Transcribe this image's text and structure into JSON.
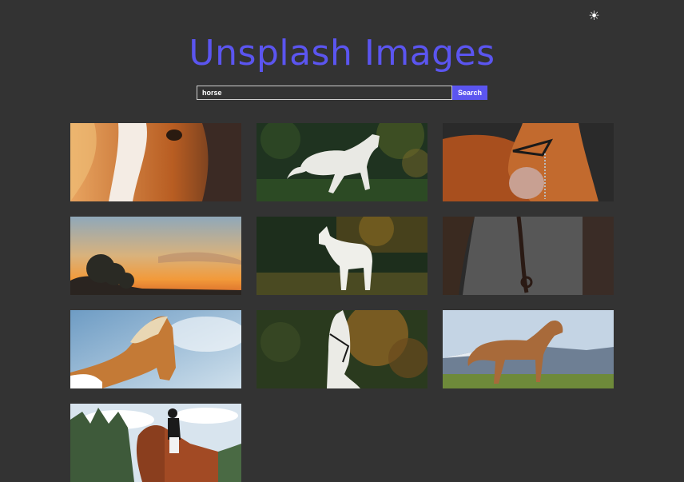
{
  "header": {
    "title": "Unsplash Images",
    "theme_icon": "sun-icon"
  },
  "search": {
    "value": "horse",
    "button_label": "Search"
  },
  "colors": {
    "background": "#333333",
    "accent": "#5b55f0",
    "text": "#ffffff"
  },
  "results": [
    {
      "subject": "horse-face-closeup"
    },
    {
      "subject": "white-horse-galloping"
    },
    {
      "subject": "chestnut-horse-bridle"
    },
    {
      "subject": "sunset-over-trees"
    },
    {
      "subject": "white-horse-standing-in-forest"
    },
    {
      "subject": "dark-horse-closeup"
    },
    {
      "subject": "palomino-horse-sky"
    },
    {
      "subject": "white-horse-portrait"
    },
    {
      "subject": "brown-horse-mountains"
    },
    {
      "subject": "horse-rider-dressage"
    }
  ]
}
